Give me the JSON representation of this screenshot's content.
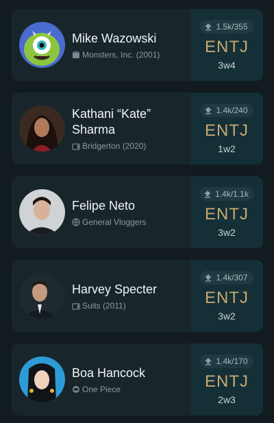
{
  "profiles": [
    {
      "name": "Mike Wazowski",
      "source": "Monsters, Inc. (2001)",
      "source_icon": "movie-icon",
      "stats": "1.5k/355",
      "mbti": "ENTJ",
      "enneagram": "3w4"
    },
    {
      "name": "Kathani “Kate” Sharma",
      "source": "Bridgerton (2020)",
      "source_icon": "tv-icon",
      "stats": "1.4k/240",
      "mbti": "ENTJ",
      "enneagram": "1w2"
    },
    {
      "name": "Felipe Neto",
      "source": "General Vloggers",
      "source_icon": "globe-icon",
      "stats": "1.4k/1.1k",
      "mbti": "ENTJ",
      "enneagram": "3w2"
    },
    {
      "name": "Harvey Specter",
      "source": "Suits (2011)",
      "source_icon": "tv-icon",
      "stats": "1.4k/307",
      "mbti": "ENTJ",
      "enneagram": "3w2"
    },
    {
      "name": "Boa Hancock",
      "source": "One Piece",
      "source_icon": "anime-icon",
      "stats": "1.4k/170",
      "mbti": "ENTJ",
      "enneagram": "2w3"
    }
  ],
  "colors": {
    "background": "#121b1f",
    "card": "#18262b",
    "type_panel": "#142f36",
    "mbti_text": "#c8a872"
  }
}
